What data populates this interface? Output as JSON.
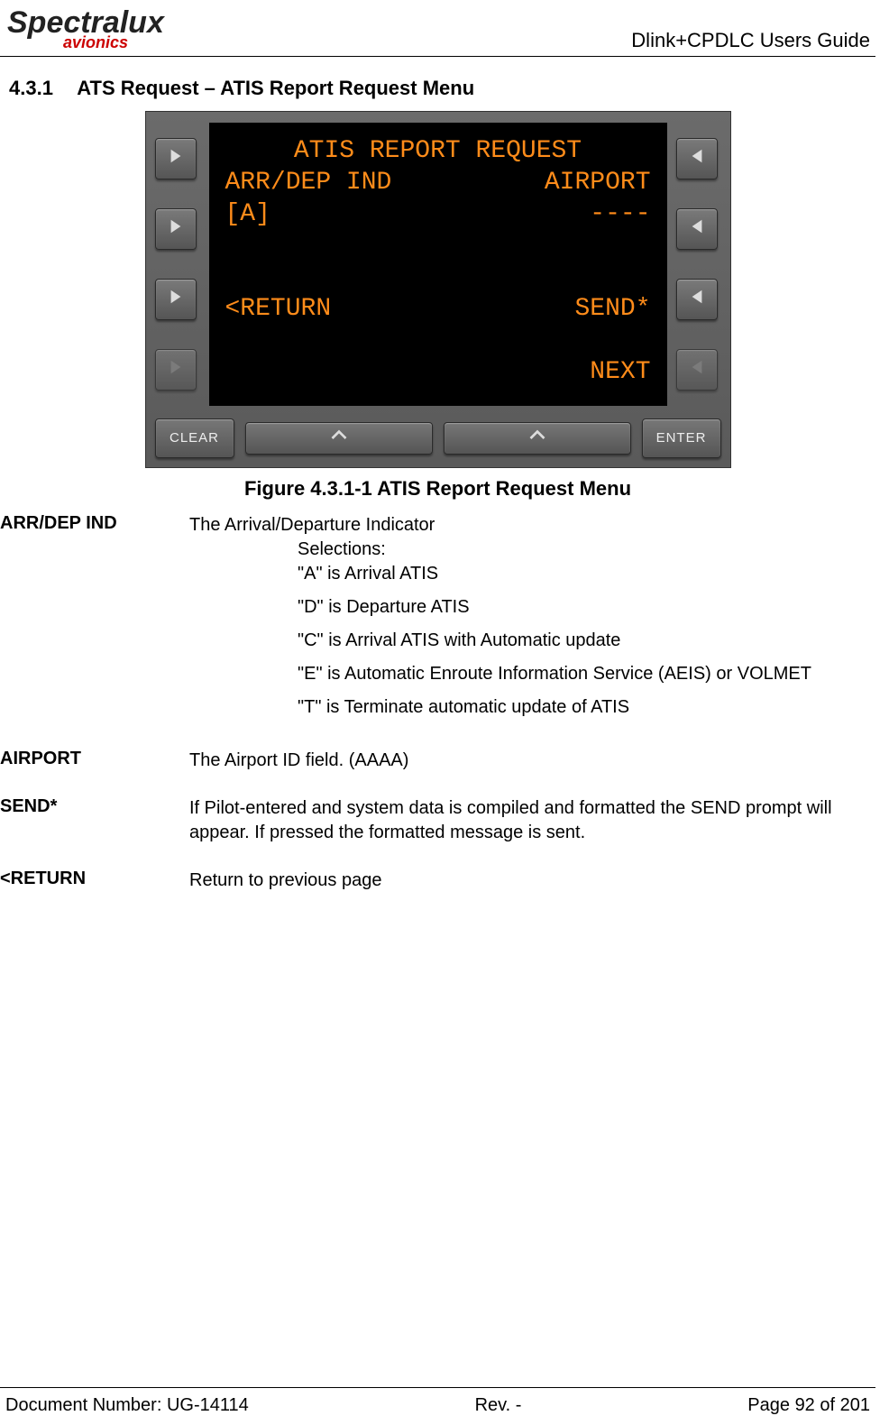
{
  "header": {
    "logo_main": "Spectralux",
    "logo_sub": "avionics",
    "doc_title": "Dlink+CPDLC Users Guide"
  },
  "section": {
    "number": "4.3.1",
    "title": "ATS Request – ATIS Report Request Menu"
  },
  "device": {
    "screen": {
      "title": "ATIS REPORT REQUEST",
      "row1_left": "ARR/DEP IND",
      "row1_right": "AIRPORT",
      "row2_left": "[A]",
      "row2_right": "----",
      "row3_left": "<RETURN",
      "row3_right": "SEND*",
      "row4_right": "NEXT"
    },
    "buttons": {
      "clear": "CLEAR",
      "enter": "ENTER"
    }
  },
  "figure_caption": "Figure 4.3.1-1 ATIS Report Request Menu",
  "definitions": {
    "arrdep": {
      "term": "ARR/DEP IND",
      "intro": "The Arrival/Departure Indicator",
      "selections_label": "Selections:",
      "opt_a": "\"A\" is Arrival ATIS",
      "opt_d": "\"D\" is Departure ATIS",
      "opt_c": "\"C\" is Arrival ATIS with Automatic update",
      "opt_e": "\"E\" is Automatic Enroute Information Service (AEIS) or VOLMET",
      "opt_t": "\"T\" is Terminate automatic update of ATIS"
    },
    "airport": {
      "term": "AIRPORT",
      "body": "The Airport ID field. (AAAA)"
    },
    "send": {
      "term": "SEND*",
      "body": "If Pilot-entered and system data is compiled and formatted the SEND prompt will appear.  If pressed the formatted message is sent."
    },
    "return": {
      "term": "<RETURN",
      "body": "Return to previous page"
    }
  },
  "footer": {
    "docnum": "Document Number:  UG-14114",
    "rev": "Rev. -",
    "page": "Page 92 of 201"
  }
}
